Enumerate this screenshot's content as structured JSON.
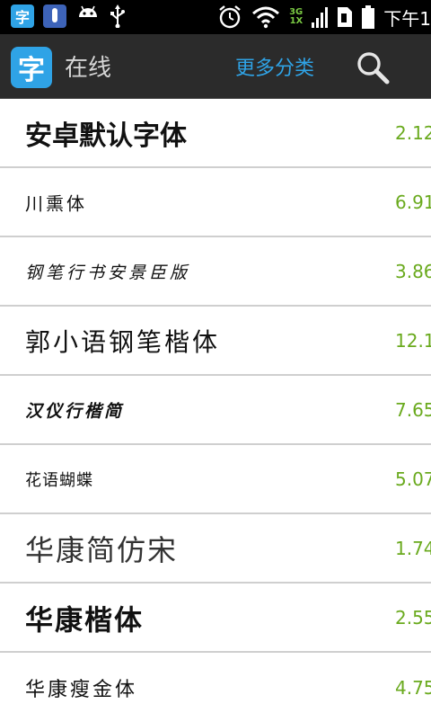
{
  "statusbar": {
    "app_icon_char": "字",
    "net_top": "3G",
    "net_bottom": "1X",
    "time": "下午1"
  },
  "header": {
    "logo_char": "字",
    "title": "在线",
    "more_categories": "更多分类"
  },
  "fonts": [
    {
      "name": "安卓默认字体",
      "size": "2.12"
    },
    {
      "name": "川熏体",
      "size": "6.91"
    },
    {
      "name": "钢笔行书安景臣版",
      "size": "3.86"
    },
    {
      "name": "郭小语钢笔楷体",
      "size": "12.1"
    },
    {
      "name": "汉仪行楷简",
      "size": "7.65"
    },
    {
      "name": "花语蝴蝶",
      "size": "5.07"
    },
    {
      "name": "华康简仿宋",
      "size": "1.74"
    },
    {
      "name": "华康楷体",
      "size": "2.55"
    },
    {
      "name": "华康瘦金体",
      "size": "4.75"
    }
  ],
  "colors": {
    "accent": "#2fa3e6",
    "size_text": "#6aaa1e",
    "actionbar": "#2b2b2b"
  }
}
